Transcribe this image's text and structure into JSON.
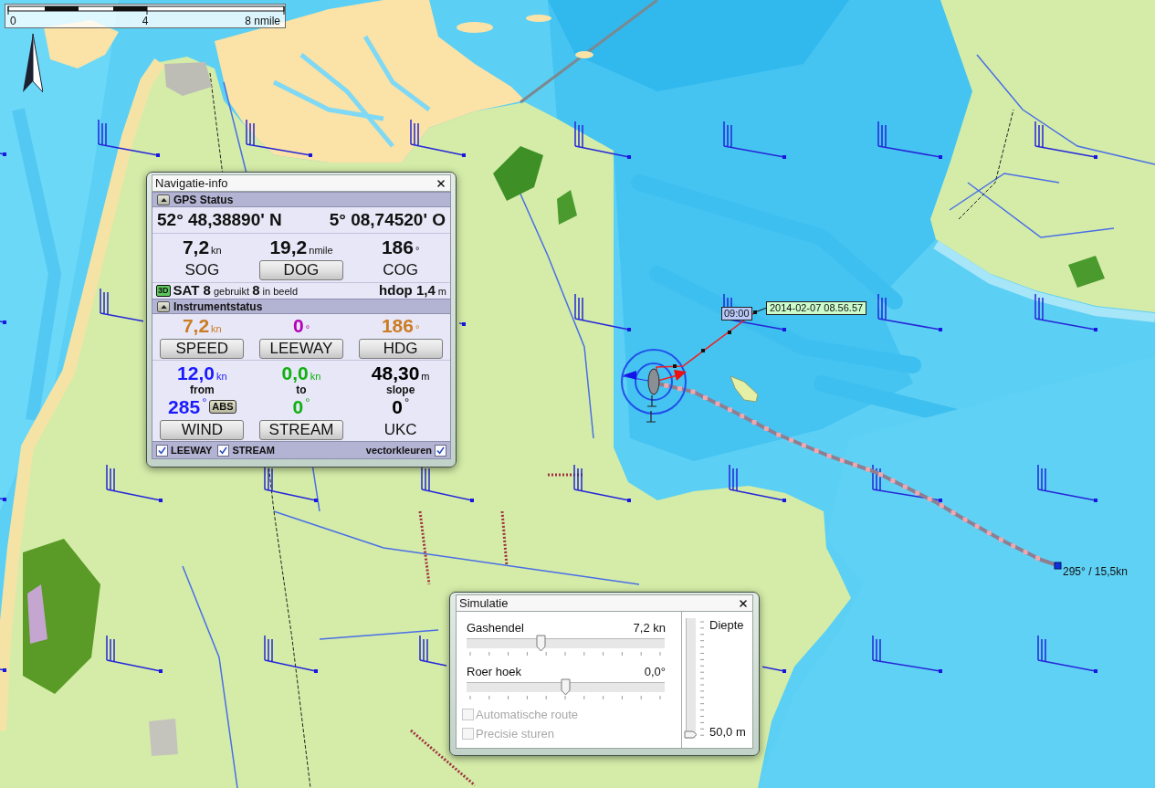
{
  "scale_bar": {
    "labels": [
      "0",
      "4",
      "8 nmile"
    ]
  },
  "vessel": {
    "time_label": "09:00",
    "timestamp": "2014-02-07 08.56.57",
    "track_end_label": "295° / 15,5kn"
  },
  "navigation_window": {
    "title": "Navigatie-info",
    "gps_status": {
      "header": "GPS Status",
      "expanded": true,
      "latitude": "52° 48,38890' N",
      "longitude": "5° 08,74520' O",
      "readings": [
        {
          "kind": "text",
          "value": "7,2",
          "unit": "kn",
          "label": "SOG"
        },
        {
          "kind": "button",
          "value": "19,2",
          "unit": "nmile",
          "label": "DOG"
        },
        {
          "kind": "text",
          "value": "186",
          "unit": "°",
          "label": "COG"
        }
      ],
      "fix": "3D",
      "satellites": "**SAT 8** gebruikt **8** in beeld",
      "hdop": "**hdop 1,4** m"
    },
    "instrument_status": {
      "header": "Instrumentstatus",
      "expanded": true,
      "vessel_readings": [
        {
          "kind": "button",
          "value": "7,2",
          "unit": "kn",
          "color": "#cc7c22",
          "label": "SPEED"
        },
        {
          "kind": "button",
          "value": "0",
          "unit": "°",
          "color": "#b400b4",
          "label": "LEEWAY"
        },
        {
          "kind": "button",
          "value": "186",
          "unit": "°",
          "color": "#cc7c22",
          "label": "HDG"
        }
      ],
      "environment_readings": [
        {
          "kind": "button",
          "value": "12,0",
          "unit": "kn",
          "caption": "from",
          "angle": "285",
          "angle_unit": "°",
          "badge": "ABS",
          "color": "#1a1aff",
          "label": "WIND"
        },
        {
          "kind": "button",
          "value": "0,0",
          "unit": "kn",
          "caption": "to",
          "angle": "0",
          "angle_unit": "°",
          "color": "#10b010",
          "label": "STREAM"
        },
        {
          "kind": "text",
          "value": "48,30",
          "unit": "m",
          "caption": "slope",
          "angle": "0",
          "angle_unit": "°",
          "color": "#000000",
          "label": "UKC"
        }
      ]
    },
    "options": [
      {
        "label": "LEEWAY",
        "checked": true
      },
      {
        "label": "STREAM",
        "checked": true
      }
    ],
    "vector_colors": {
      "label": "vectorkleuren",
      "checked": true
    }
  },
  "simulation_window": {
    "title": "Simulatie",
    "sliders": [
      {
        "label": "Gashendel",
        "reading": "7,2 kn",
        "level": 0.37
      },
      {
        "label": "Roer hoek",
        "reading": "0,0°",
        "level": 0.5
      }
    ],
    "options": [
      {
        "label": "Automatische route",
        "checked": false,
        "disabled": true
      },
      {
        "label": "Precisie sturen",
        "checked": false,
        "disabled": true
      }
    ],
    "depth": {
      "label": "Diepte",
      "reading": "50,0 m",
      "level": 0
    }
  }
}
